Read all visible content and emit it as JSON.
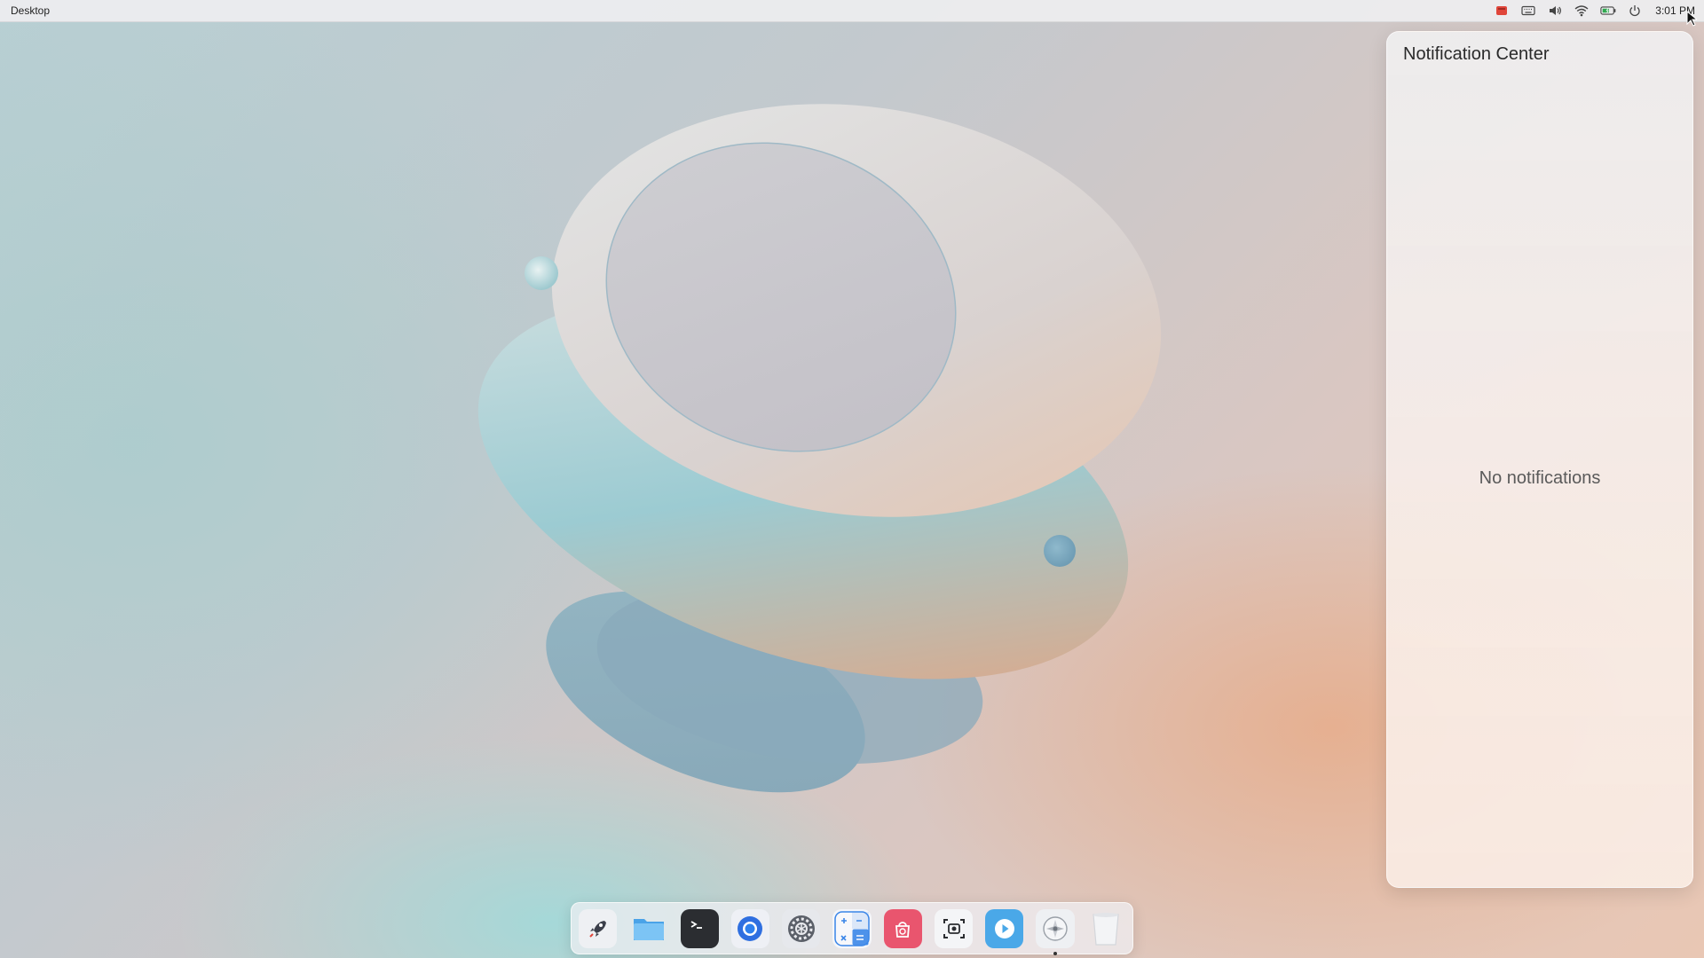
{
  "top_panel": {
    "app_name": "Desktop",
    "clock": "3:01 PM",
    "tray_icons": [
      "app-indicator-icon",
      "keyboard-icon",
      "volume-icon",
      "wifi-icon",
      "battery-icon",
      "power-icon"
    ]
  },
  "notification_center": {
    "title": "Notification Center",
    "empty_text": "No notifications"
  },
  "dock": {
    "items": [
      {
        "name": "launcher",
        "icon": "rocket-icon"
      },
      {
        "name": "file-manager",
        "icon": "folder-icon"
      },
      {
        "name": "terminal",
        "icon": "terminal-icon"
      },
      {
        "name": "browser",
        "icon": "browser-icon"
      },
      {
        "name": "settings",
        "icon": "gear-icon"
      },
      {
        "name": "calculator",
        "icon": "calculator-icon"
      },
      {
        "name": "app-store",
        "icon": "store-icon"
      },
      {
        "name": "screenshot",
        "icon": "screenshot-icon"
      },
      {
        "name": "video-player",
        "icon": "play-icon"
      },
      {
        "name": "control-center",
        "icon": "control-center-icon",
        "running": true
      },
      {
        "name": "trash",
        "icon": "trash-icon"
      }
    ]
  },
  "colors": {
    "panel_bg": "#eeeef0",
    "accent_blue": "#2f80ed",
    "store_pink": "#e9556e"
  }
}
